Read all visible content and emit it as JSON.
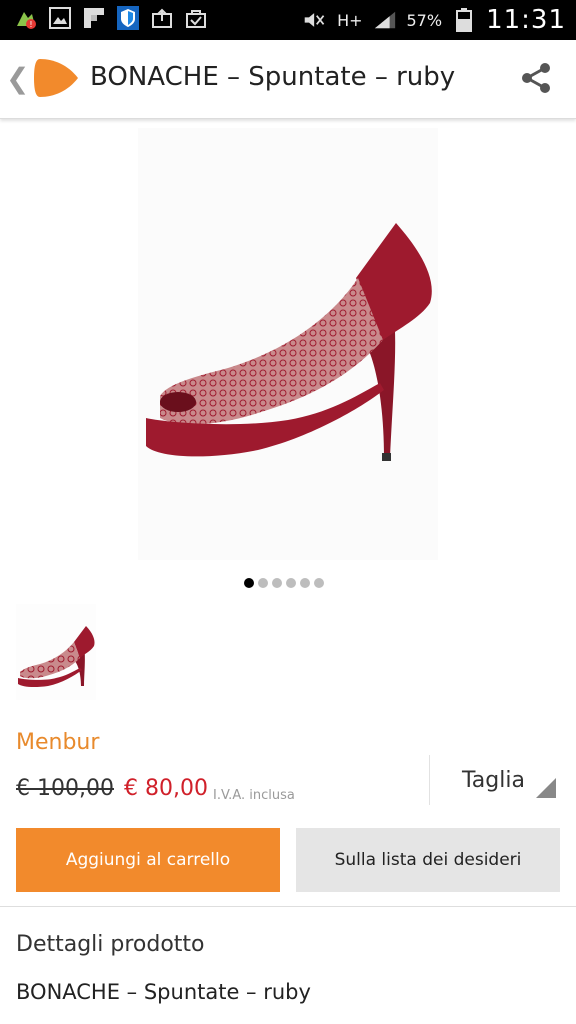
{
  "status_bar": {
    "icons": [
      "notification-alert-icon",
      "image-icon",
      "flipboard-icon",
      "shield-icon",
      "upload-bag-icon",
      "shopping-bag-check-icon"
    ],
    "network": "H+",
    "battery_percent": "57%",
    "time": "11:31"
  },
  "app_bar": {
    "back_glyph": "❮",
    "title": "BONACHE  – Spuntate – ruby",
    "share_icon": "share-icon",
    "logo_color": "#f28a2c"
  },
  "gallery": {
    "image_count": 6,
    "active_index": 0
  },
  "product": {
    "brand": "Menbur",
    "old_price": "€ 100,00",
    "new_price": "€ 80,00",
    "vat_note": "I.V.A. inclusa",
    "size_label": "Taglia"
  },
  "actions": {
    "add_to_cart": "Aggiungi al carrello",
    "wishlist": "Sulla lista dei desideri"
  },
  "details": {
    "title": "Dettagli prodotto",
    "name": "BONACHE  – Spuntate – ruby"
  },
  "colors": {
    "accent": "#f28a2c",
    "price_red": "#d0202a",
    "shoe_red": "#9e1a2e"
  }
}
